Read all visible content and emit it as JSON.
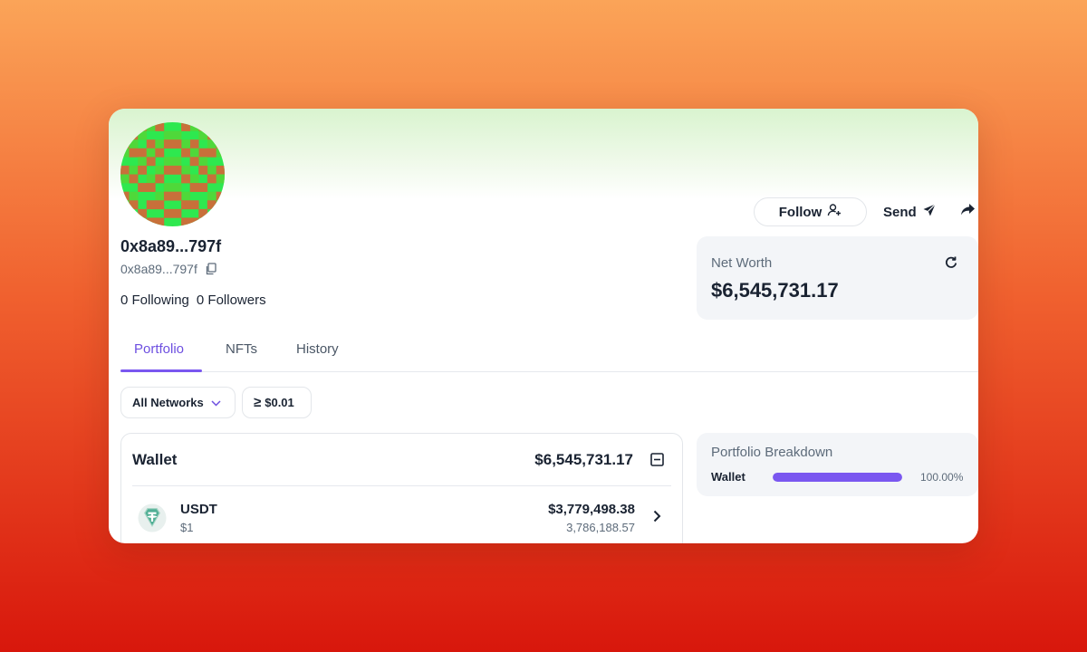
{
  "profile": {
    "display_name": "0x8a89...797f",
    "address_short": "0x8a89...797f",
    "following_count": "0",
    "following_label": "Following",
    "followers_count": "0",
    "followers_label": "Followers"
  },
  "actions": {
    "follow_label": "Follow",
    "send_label": "Send"
  },
  "net_worth": {
    "label": "Net Worth",
    "value": "$6,545,731.17"
  },
  "tabs": [
    {
      "label": "Portfolio",
      "active": true
    },
    {
      "label": "NFTs",
      "active": false
    },
    {
      "label": "History",
      "active": false
    }
  ],
  "filters": {
    "network_label": "All Networks",
    "min_value_symbol": "≥",
    "min_value_label": "$0.01"
  },
  "wallet": {
    "title": "Wallet",
    "total": "$6,545,731.17",
    "tokens": [
      {
        "symbol": "USDT",
        "price": "$1",
        "value": "$3,779,498.38",
        "amount": "3,786,188.57",
        "icon": "tether-icon"
      }
    ]
  },
  "breakdown": {
    "title": "Portfolio Breakdown",
    "rows": [
      {
        "label": "Wallet",
        "percent_label": "100.00%",
        "fraction": 1.0
      }
    ]
  },
  "colors": {
    "accent": "#7a57f0",
    "avatar_green": "#2ee84f",
    "avatar_brown": "#c8703a",
    "tether": "#50af95"
  },
  "icons": [
    "add-user-icon",
    "send-icon",
    "share-icon",
    "copy-icon",
    "refresh-icon",
    "chevron-down-icon",
    "collapse-icon",
    "chevron-right-icon",
    "tether-icon"
  ]
}
